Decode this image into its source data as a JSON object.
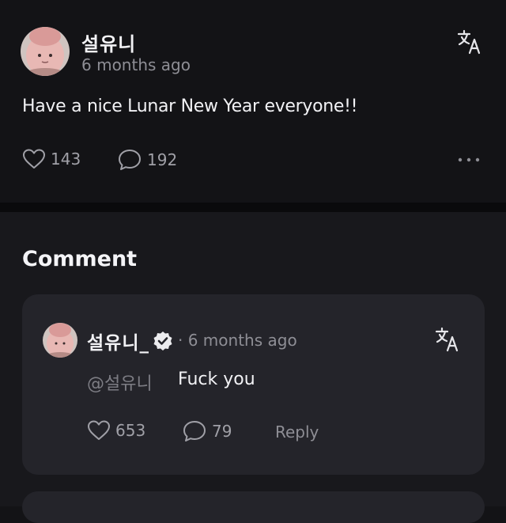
{
  "post": {
    "author": "설유니",
    "time": "6 months ago",
    "text": "Have a nice Lunar New Year everyone!!",
    "likes": "143",
    "replies": "192"
  },
  "comments_section": {
    "title": "Comment"
  },
  "comment": {
    "author": "설유니_",
    "time": "· 6 months ago",
    "mention": "@설유니",
    "text": "Fuck you",
    "likes": "653",
    "replies": "79",
    "reply_label": "Reply"
  },
  "icons": {
    "translate": "translate-icon",
    "like": "heart-icon",
    "reply": "speech-bubble-icon",
    "more": "more-options-icon",
    "verified": "verified-badge-icon"
  },
  "colors": {
    "background": "#131316",
    "card": "#24242a",
    "text": "#f2f2f5",
    "muted": "#8e8e95"
  }
}
